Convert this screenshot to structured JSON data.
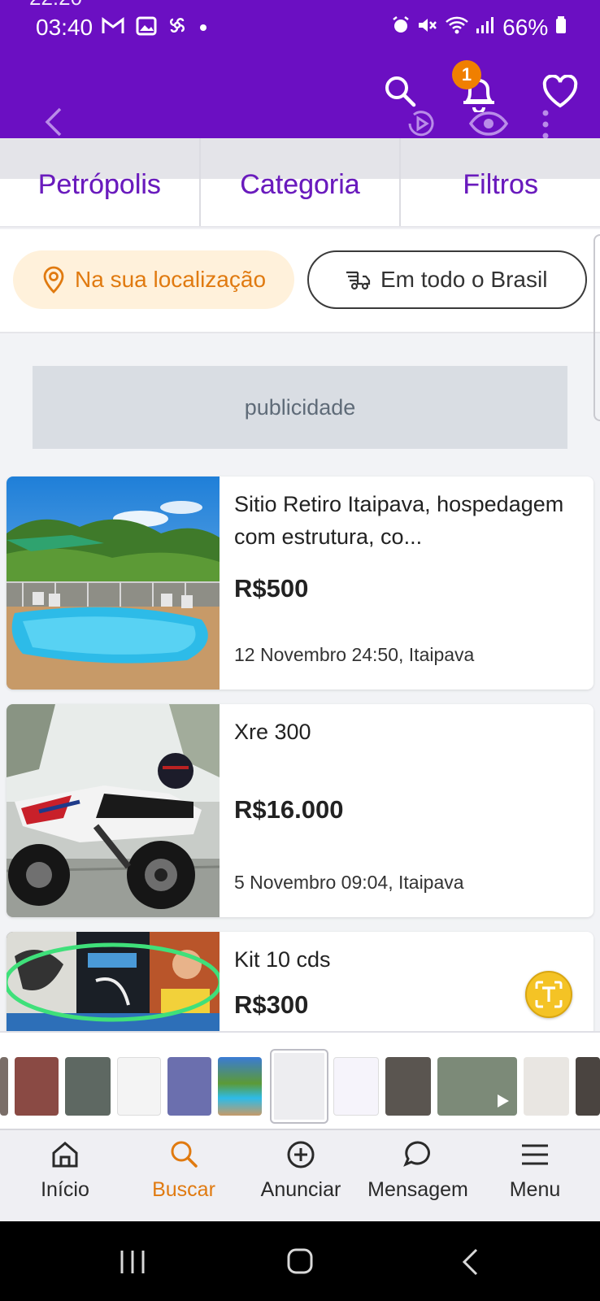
{
  "status_bar": {
    "clipped_top": "22:20",
    "time": "03:40",
    "battery": "66%"
  },
  "header": {
    "notification_count": "1"
  },
  "tabs": [
    {
      "label": "Petrópolis"
    },
    {
      "label": "Categoria"
    },
    {
      "label": "Filtros"
    }
  ],
  "location": {
    "local_label": "Na sua localização",
    "brasil_label": "Em todo o Brasil"
  },
  "ad": {
    "label": "publicidade"
  },
  "listings": [
    {
      "title": "Sitio Retiro Itaipava, hospedagem com estrutura, co...",
      "price": "R$500",
      "meta": "12 Novembro 24:50, Itaipava"
    },
    {
      "title": "Xre 300",
      "price": "R$16.000",
      "meta": "5 Novembro 09:04, Itaipava"
    },
    {
      "title": "Kit 10 cds",
      "price": "R$300",
      "meta": ""
    }
  ],
  "nav": [
    {
      "label": "Início",
      "icon": "home-icon"
    },
    {
      "label": "Buscar",
      "icon": "search-icon",
      "active": true
    },
    {
      "label": "Anunciar",
      "icon": "plus-circle-icon"
    },
    {
      "label": "Mensagem",
      "icon": "chat-icon"
    },
    {
      "label": "Menu",
      "icon": "menu-icon"
    }
  ],
  "colors": {
    "brand_purple": "#6b0fc2",
    "accent_orange": "#e07a10",
    "tab_text": "#6a1bbd"
  }
}
